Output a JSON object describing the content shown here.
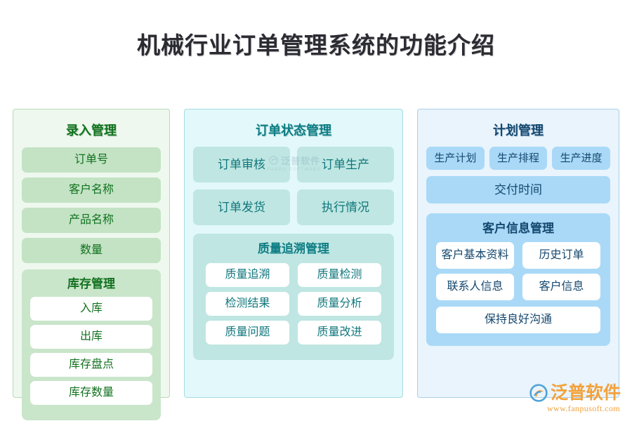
{
  "title": "机械行业订单管理系统的功能介绍",
  "columns": [
    {
      "id": "entry-management",
      "heading": "录入管理",
      "items": [
        "订单号",
        "客户名称",
        "产品名称",
        "数量"
      ],
      "subsection": {
        "id": "inventory-management",
        "heading": "库存管理",
        "items": [
          "入库",
          "出库",
          "库存盘点",
          "库存数量"
        ]
      }
    },
    {
      "id": "order-status-management",
      "heading": "订单状态管理",
      "items": [
        "订单审核",
        "订单生产",
        "订单发货",
        "执行情况"
      ],
      "subsection": {
        "id": "quality-trace-management",
        "heading": "质量追溯管理",
        "items": [
          "质量追溯",
          "质量检测",
          "检测结果",
          "质量分析",
          "质量问题",
          "质量改进"
        ]
      }
    },
    {
      "id": "plan-management",
      "heading": "计划管理",
      "items": [
        "生产计划",
        "生产排程",
        "生产进度"
      ],
      "wide_item": "交付时间",
      "subsection": {
        "id": "customer-info-management",
        "heading": "客户信息管理",
        "items": [
          "客户基本资料",
          "历史订单",
          "联系人信息",
          "客户信息"
        ],
        "wide_item": "保持良好沟通"
      }
    }
  ],
  "watermark": {
    "text": "泛普软件",
    "sub": "FANPU SOFTWARE"
  },
  "logo": {
    "text": "泛普软件",
    "url": "www.fanpusoft.com"
  },
  "colors": {
    "green_panel_bg": "#eef8ee",
    "green_pill": "#c3e3c4",
    "green_text": "#12711f",
    "teal_panel_bg": "#e2f8fa",
    "teal_pill": "#bfe6e2",
    "teal_text": "#10777c",
    "blue_panel_bg": "#eaf4fc",
    "blue_pill": "#a9d9f7",
    "blue_text": "#15486f",
    "title_text": "#2b2b32",
    "logo_orange": "#f3a13a"
  }
}
